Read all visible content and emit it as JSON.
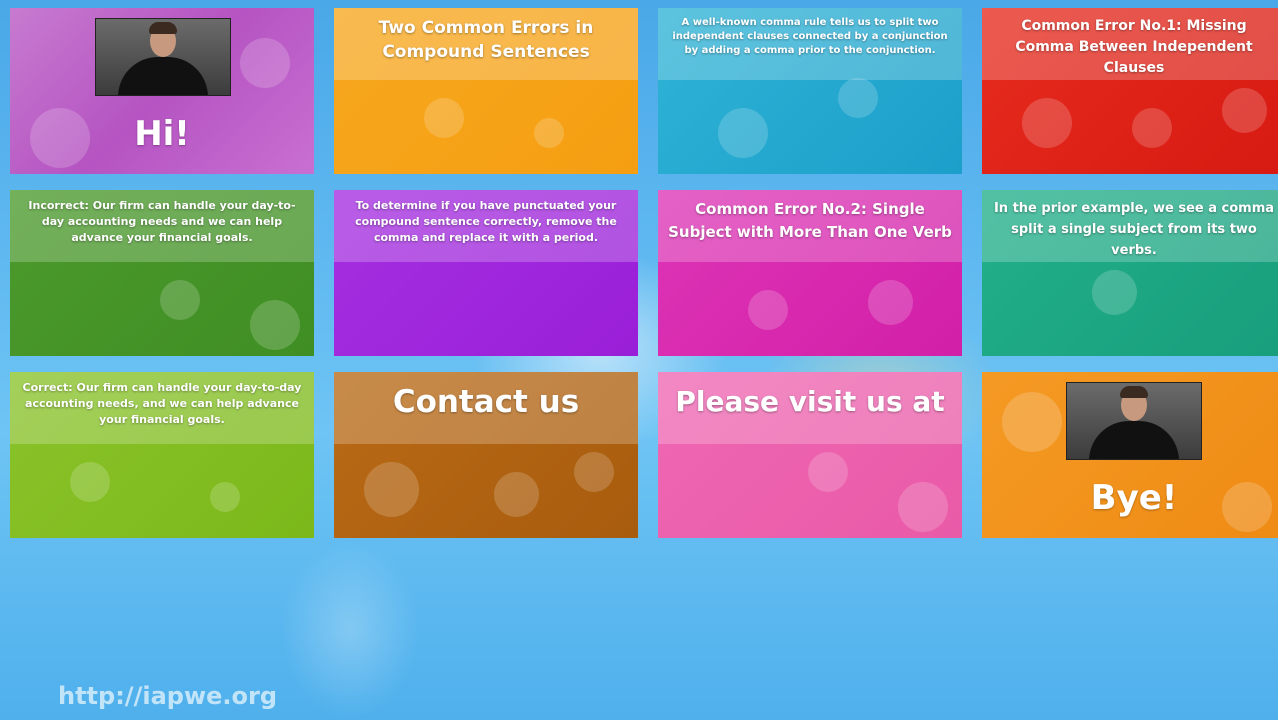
{
  "tiles": {
    "t1": {
      "greeting": "Hi!"
    },
    "t2": {
      "text": "Two Common Errors in Compound Sentences"
    },
    "t3": {
      "text": "A well-known comma rule tells us to split two independent clauses connected by a conjunction by adding a comma prior to the conjunction."
    },
    "t4": {
      "text": "Common Error No.1: Missing Comma Between Independent Clauses"
    },
    "t5": {
      "text": "Incorrect: Our firm can handle your day-to-day accounting needs and we can help advance your financial goals."
    },
    "t6": {
      "text": "To determine if you have punctuated your compound sentence correctly, remove the comma and replace it with a period."
    },
    "t7": {
      "text": "Common Error No.2: Single Subject with More Than One Verb"
    },
    "t8": {
      "text": "In the prior example, we see a comma split a single subject from its two verbs."
    },
    "t9": {
      "text": "Correct: Our firm can handle your day-to-day accounting needs, and we can help advance your financial goals."
    },
    "t10": {
      "text": "Contact us"
    },
    "t11": {
      "text": "Please visit us at"
    },
    "t12": {
      "greeting": "Bye!"
    }
  },
  "footer": {
    "url": "http://iapwe.org"
  },
  "colors": {
    "background": "#5fb8f0",
    "purple": "#b554c2",
    "orange": "#f59e12",
    "cyan": "#1c9fca",
    "red": "#d71a12",
    "green": "#3f8e24",
    "violet": "#9a1fd8",
    "magenta": "#d21fa8",
    "teal": "#189e7c",
    "lime": "#7bb81a",
    "brown": "#a85c0d",
    "pink": "#e95aa7",
    "orange_alt": "#ef8b14"
  }
}
